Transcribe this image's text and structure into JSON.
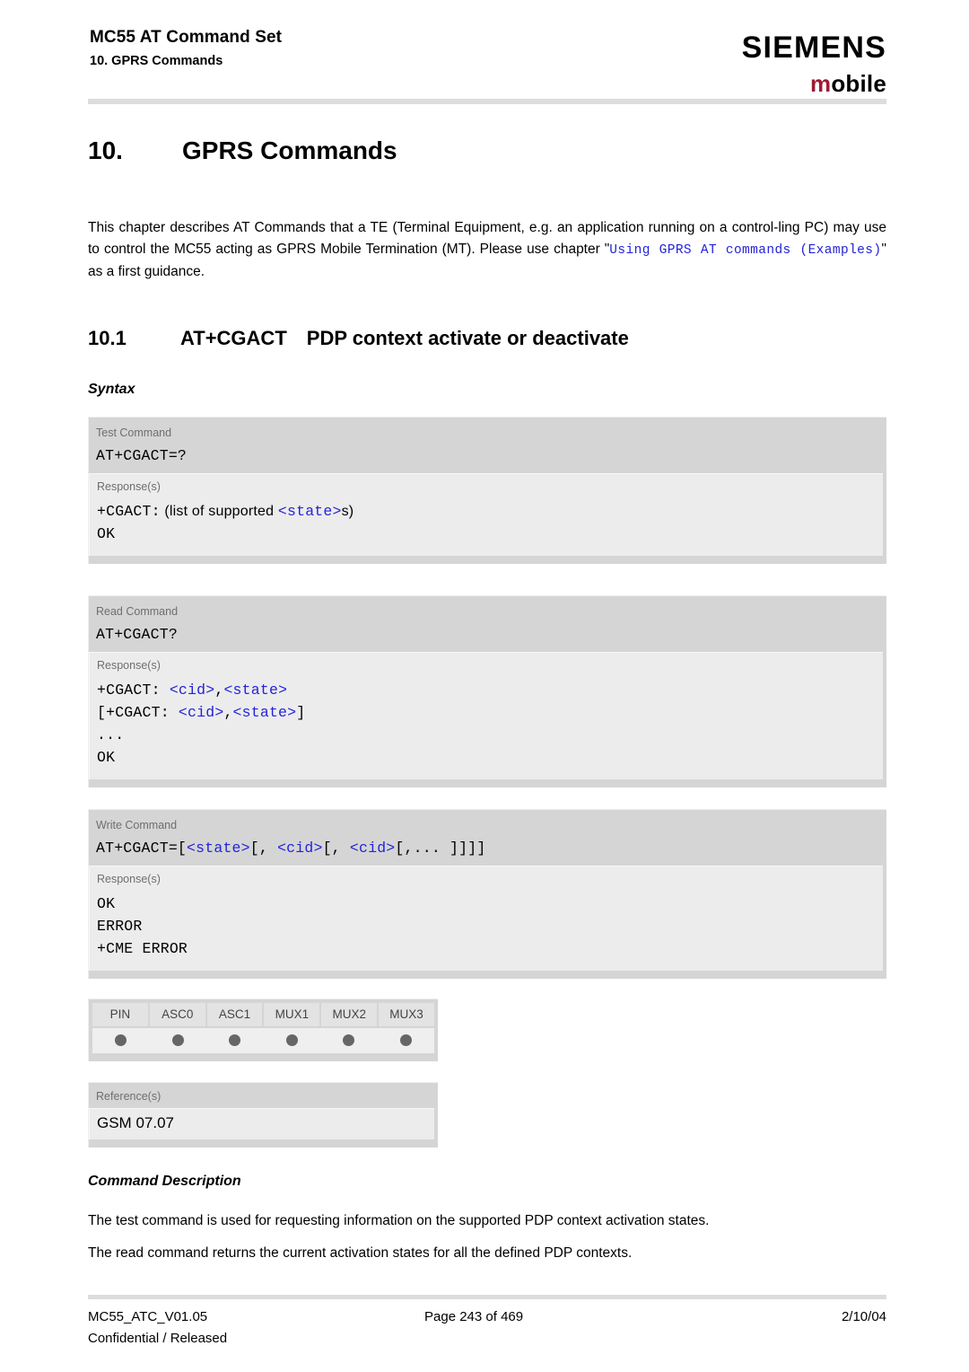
{
  "header": {
    "title": "MC55 AT Command Set",
    "subtitle": "10. GPRS Commands",
    "logo_primary": "SIEMENS",
    "logo_secondary_m": "m",
    "logo_secondary_rest": "obile",
    "brand_color": "#9e1b32"
  },
  "chapter": {
    "number": "10.",
    "title": "GPRS Commands"
  },
  "intro": {
    "part1": "This chapter describes AT Commands that a TE (Terminal Equipment, e.g. an application running on a control-ling PC) may use to control the MC55 acting as GPRS Mobile Termination (MT). Please use chapter \"",
    "link": "Using GPRS AT commands (Examples)",
    "part2": "\" as a first guidance."
  },
  "section": {
    "number": "10.1",
    "command": "AT+CGACT",
    "title": "PDP context activate or deactivate"
  },
  "headings": {
    "syntax": "Syntax",
    "command_description": "Command Description"
  },
  "syntax_blocks": [
    {
      "label": "Test Command",
      "command": "AT+CGACT=?",
      "response_label": "Response(s)",
      "response_lines": [
        [
          {
            "text": "+CGACT:",
            "style": "mono"
          },
          {
            "text": "  (list of supported ",
            "style": "sans"
          },
          {
            "text": "<state>",
            "style": "mono-blue"
          },
          {
            "text": "s)",
            "style": "sans"
          }
        ],
        [
          {
            "text": "OK",
            "style": "mono"
          }
        ]
      ]
    },
    {
      "label": "Read Command",
      "command": "AT+CGACT?",
      "response_label": "Response(s)",
      "response_lines": [
        [
          {
            "text": "+CGACT: ",
            "style": "mono"
          },
          {
            "text": "<cid>",
            "style": "mono-blue"
          },
          {
            "text": ",",
            "style": "mono"
          },
          {
            "text": "<state>",
            "style": "mono-blue"
          }
        ],
        [
          {
            "text": "[+CGACT: ",
            "style": "mono"
          },
          {
            "text": "<cid>",
            "style": "mono-blue"
          },
          {
            "text": ",",
            "style": "mono"
          },
          {
            "text": "<state>",
            "style": "mono-blue"
          },
          {
            "text": "]",
            "style": "mono"
          }
        ],
        [
          {
            "text": "...",
            "style": "mono"
          }
        ],
        [
          {
            "text": "OK",
            "style": "mono"
          }
        ]
      ]
    },
    {
      "label": "Write Command",
      "command_parts": [
        {
          "text": "AT+CGACT=[",
          "style": "mono"
        },
        {
          "text": "<state>",
          "style": "mono-blue"
        },
        {
          "text": "[, ",
          "style": "mono"
        },
        {
          "text": "<cid>",
          "style": "mono-blue"
        },
        {
          "text": "[, ",
          "style": "mono"
        },
        {
          "text": "<cid>",
          "style": "mono-blue"
        },
        {
          "text": "[,... ]]]]",
          "style": "mono"
        }
      ],
      "response_label": "Response(s)",
      "response_lines": [
        [
          {
            "text": "OK",
            "style": "mono"
          }
        ],
        [
          {
            "text": "ERROR",
            "style": "mono"
          }
        ],
        [
          {
            "text": "+CME ERROR",
            "style": "mono"
          }
        ]
      ]
    }
  ],
  "pin_table": {
    "columns": [
      "PIN",
      "ASC0",
      "ASC1",
      "MUX1",
      "MUX2",
      "MUX3"
    ],
    "dots": [
      true,
      true,
      true,
      true,
      true,
      true
    ],
    "dot_color": "#666666"
  },
  "reference": {
    "label": "Reference(s)",
    "value": "GSM 07.07"
  },
  "description": {
    "paragraph1": "The test command is used for requesting information on the supported PDP context activation states.",
    "paragraph2": "The read command returns the current activation states for all the defined PDP contexts."
  },
  "footer": {
    "doc_id": "MC55_ATC_V01.05",
    "classification": "Confidential / Released",
    "page": "Page 243 of 469",
    "date": "2/10/04"
  }
}
